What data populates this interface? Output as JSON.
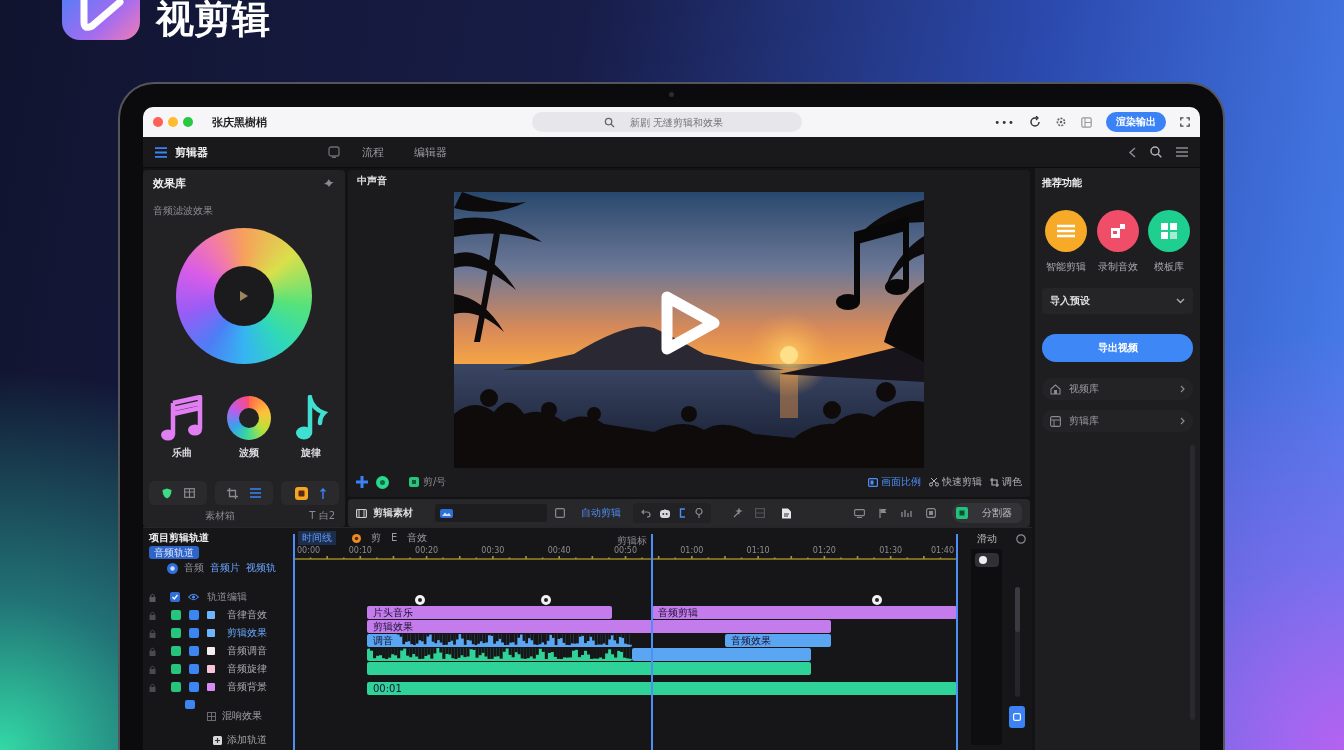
{
  "brand": {
    "name": "视剪辑"
  },
  "window": {
    "title": "张庆黑樹梢",
    "search": {
      "placeholder": "新剧 无缝剪辑和效果"
    },
    "more": "•••",
    "export_button": "渲染输出"
  },
  "toolbar": {
    "workspace": "剪辑器",
    "tabs": [
      {
        "label": "流程",
        "selected": false
      },
      {
        "label": "编辑器",
        "selected": false
      }
    ]
  },
  "effects_panel": {
    "title": "效果库",
    "subtitle": "音频滤波效果",
    "presets": [
      {
        "kind": "notes",
        "label": "乐曲"
      },
      {
        "kind": "ring",
        "label": "波频"
      },
      {
        "kind": "note",
        "label": "旋律"
      }
    ],
    "footer": {
      "label": "素材箱",
      "shortcut": "T 白2"
    }
  },
  "preview": {
    "title": "中声音",
    "clip_label": "剪/号",
    "actions": [
      {
        "kind": "ratio",
        "label": "画面比例",
        "selected": true
      },
      {
        "kind": "cut",
        "label": "快速剪辑",
        "selected": false
      },
      {
        "kind": "color",
        "label": "调色",
        "selected": false
      }
    ]
  },
  "edit_toolbar": {
    "title": "剪辑素材",
    "auto_button": "自动剪辑",
    "split_button": "分割器"
  },
  "timeline": {
    "title": "项目剪辑轨道",
    "chip": "音频轨道",
    "filters": [
      {
        "label": "音频",
        "selected": false
      },
      {
        "label": "音频片",
        "selected": true
      },
      {
        "label": "视频轨",
        "selected": true
      }
    ],
    "column_header": "轨道编辑",
    "tracks": [
      {
        "name": "音律音效",
        "selected": false,
        "visible": true,
        "audible": true,
        "color": "#6eb4ff"
      },
      {
        "name": "剪辑效果",
        "selected": true,
        "visible": true,
        "audible": true,
        "color": "#6eb4ff"
      },
      {
        "name": "音频调音",
        "selected": false,
        "visible": true,
        "audible": true,
        "color": "#f4eef2"
      },
      {
        "name": "音频旋律",
        "selected": false,
        "visible": true,
        "audible": true,
        "color": "#f7c4d6"
      },
      {
        "name": "音频背景",
        "selected": false,
        "visible": true,
        "audible": true,
        "color": "#d68cf0"
      }
    ],
    "extra_label": "混响效果",
    "footer_label": "添加轨道",
    "ruler": {
      "tab": "时间线",
      "tools": [
        "剪",
        "E",
        "音效"
      ],
      "marker_label": "剪辑标",
      "ticks": [
        "00:00",
        "00:10",
        "00:20",
        "00:30",
        "00:40",
        "00:50",
        "01:00",
        "01:10",
        "01:20",
        "01:30",
        "01:40"
      ]
    },
    "rows": [
      {
        "clips": [
          {
            "kind": "bar",
            "label": "片头音乐",
            "color": "#c47cec"
          },
          {
            "kind": "bar",
            "label": "音频剪辑",
            "color": "#c47cec"
          }
        ]
      },
      {
        "clips": [
          {
            "kind": "bar",
            "label": "剪辑效果",
            "color": "#c47cec"
          }
        ]
      },
      {
        "clips": [
          {
            "kind": "wave",
            "label": "调音",
            "color": "#5aa6f2"
          },
          {
            "kind": "bar",
            "label": "音频效果",
            "color": "#5aa6f2"
          }
        ]
      },
      {
        "clips": [
          {
            "kind": "wave",
            "color": "#2fd39a"
          },
          {
            "kind": "bar",
            "color": "#5aa6f2"
          }
        ]
      },
      {
        "clips": [
          {
            "kind": "bar",
            "color": "#2fd39a"
          }
        ]
      },
      {
        "clips": [
          {
            "kind": "bar",
            "label": "00:01",
            "color": "#2fd39a"
          }
        ]
      }
    ],
    "side_label": "滑动"
  },
  "side_panel": {
    "title": "推荐功能",
    "features": [
      {
        "kind": "list",
        "label": "智能剪辑",
        "color": "#f7a928"
      },
      {
        "kind": "document",
        "label": "录制音效",
        "color": "#ef4d68"
      },
      {
        "kind": "grid",
        "label": "模板库",
        "color": "#1fcf8f"
      }
    ],
    "section": "导入预设",
    "primary_button": "导出视频",
    "links": [
      {
        "kind": "library",
        "label": "视频库"
      },
      {
        "kind": "effects",
        "label": "剪辑库"
      }
    ]
  }
}
